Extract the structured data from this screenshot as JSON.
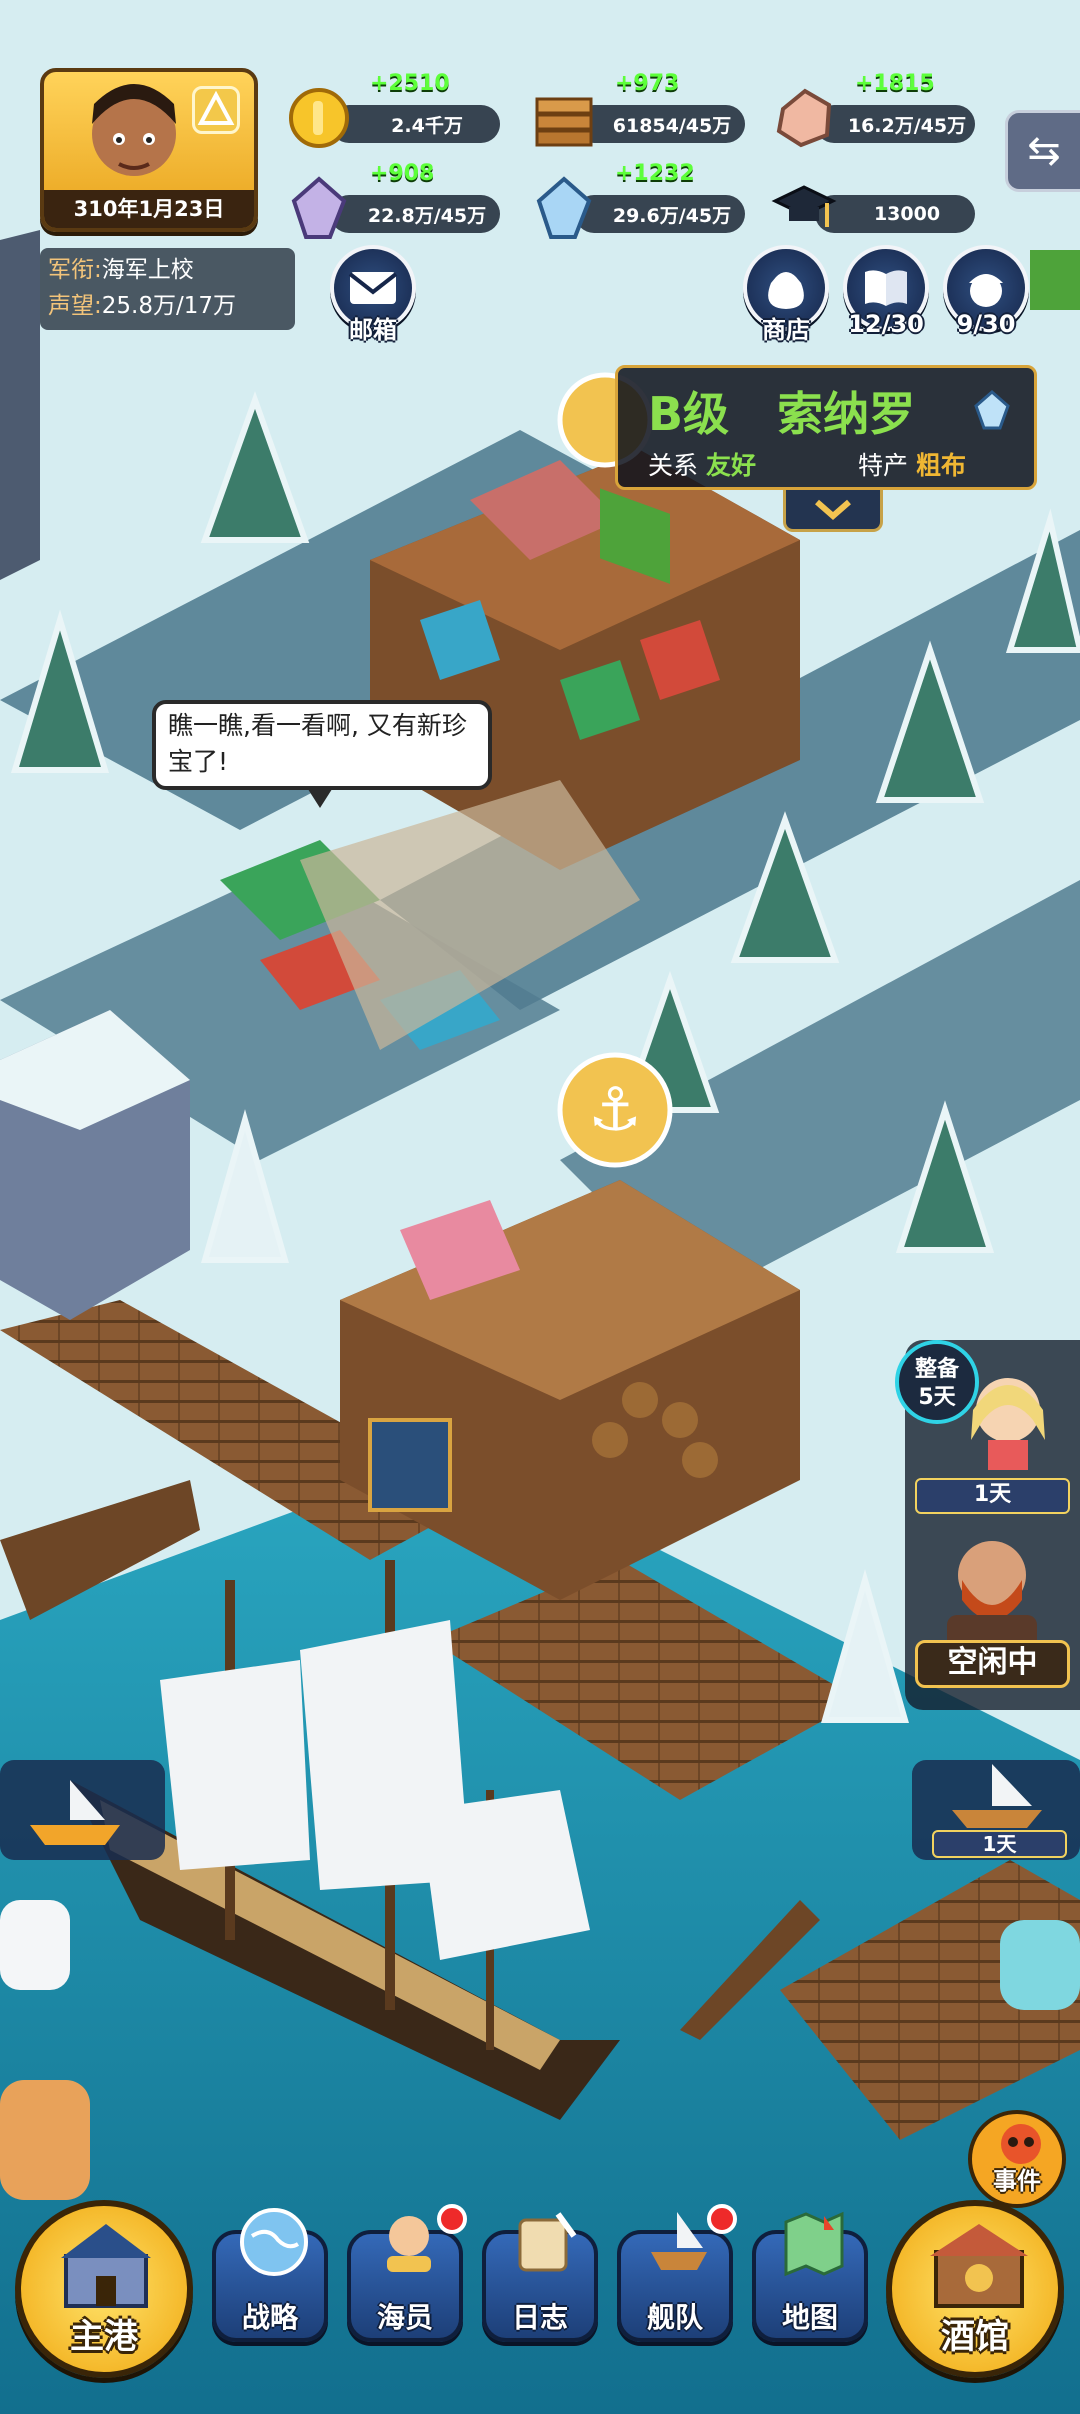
{
  "player": {
    "date": "310年1月23日",
    "rank_label": "军衔:",
    "rank_value": "海军上校",
    "fame_label": "声望:",
    "fame_value": "25.8万/17万"
  },
  "resources": {
    "gold": {
      "gain": "+2510",
      "value": "2.4千万"
    },
    "wood": {
      "gain": "+973",
      "value": "61854/45万"
    },
    "ore": {
      "gain": "+1815",
      "value": "16.2万/45万"
    },
    "crystal": {
      "gain": "+908",
      "value": "22.8万/45万"
    },
    "diamond": {
      "gain": "+1232",
      "value": "29.6万/45万"
    },
    "scholar": {
      "value": "13000"
    }
  },
  "top_buttons": {
    "mail": "邮箱",
    "shop": "商店",
    "log": "12/30",
    "crew": "9/30"
  },
  "city": {
    "grade": "B级",
    "name": "索纳罗",
    "relation_label": "关系",
    "relation_value": "友好",
    "specialty_label": "特产",
    "specialty_value": "粗布"
  },
  "speech": "瞧一瞧,看一看啊, 又有新珍宝了!",
  "side": {
    "cheer_line1": "整备",
    "cheer_line2": "5天",
    "days_tag": "1天",
    "idle": "空闲中",
    "boat_days": "1天"
  },
  "event": "事件",
  "nav": {
    "home": "主港",
    "strategy": "战略",
    "crew": "海员",
    "journal": "日志",
    "fleet": "舰队",
    "map": "地图",
    "tavern": "酒馆"
  },
  "colors": {
    "snow": "#d8eef2",
    "road": "#4f7a8f",
    "sea": "#1e8aa8",
    "gain_green": "#5dff3a",
    "gold": "#f4c430"
  }
}
